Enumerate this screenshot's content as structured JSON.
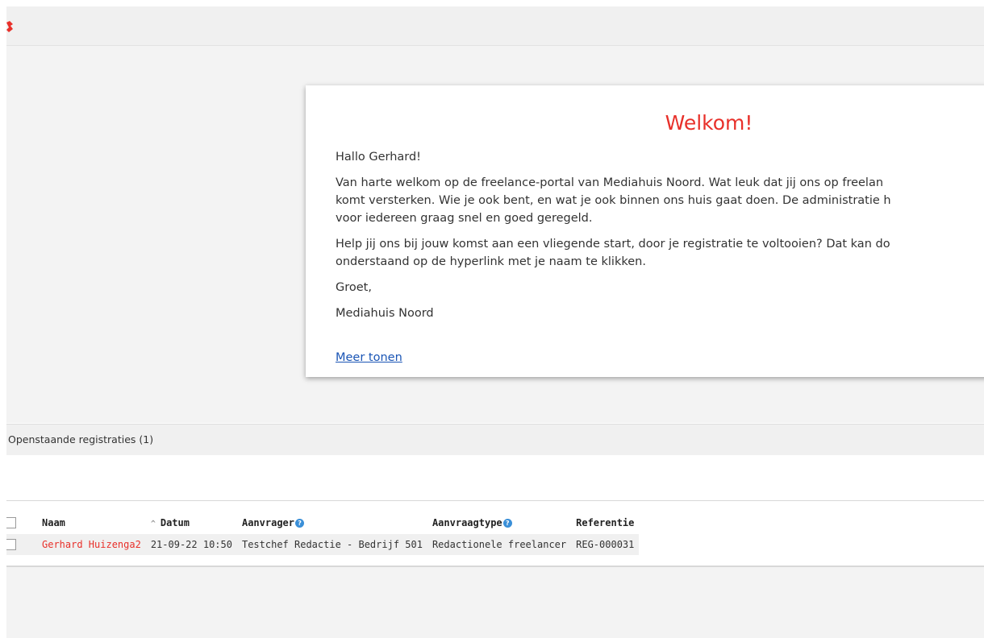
{
  "welcome": {
    "title": "Welkom!",
    "greeting": "Hallo Gerhard!",
    "paragraph1_line1": "Van harte welkom op de freelance-portal van Mediahuis Noord. Wat leuk dat jij ons op freelan",
    "paragraph1_line2": "komt versterken. Wie je ook bent, en wat je ook binnen ons huis gaat doen. De administratie h",
    "paragraph1_line3": "voor iedereen graag snel en goed geregeld.",
    "paragraph2_line1": "Help jij ons bij jouw komst aan een vliegende start, door je registratie te voltooien? Dat kan do",
    "paragraph2_line2": "onderstaand op de hyperlink met je naam te klikken.",
    "closing": "Groet,",
    "signature": "Mediahuis Noord",
    "more_link": "Meer tonen"
  },
  "registrations": {
    "section_title": "Openstaande registraties (1)",
    "columns": {
      "naam": "Naam",
      "datum": "Datum",
      "aanvrager": "Aanvrager",
      "aanvraagtype": "Aanvraagtype",
      "referentie": "Referentie"
    },
    "rows": [
      {
        "naam": "Gerhard Huizenga2",
        "datum": "21-09-22 10:50",
        "aanvrager": "Testchef Redactie - Bedrijf 501",
        "aanvraagtype": "Redactionele freelancer",
        "referentie": "REG-000031"
      }
    ]
  },
  "icons": {
    "help": "?",
    "sort": "^"
  },
  "colors": {
    "accent_red": "#e8302a",
    "link_blue": "#1a55b5",
    "help_blue": "#3a8fd8"
  }
}
